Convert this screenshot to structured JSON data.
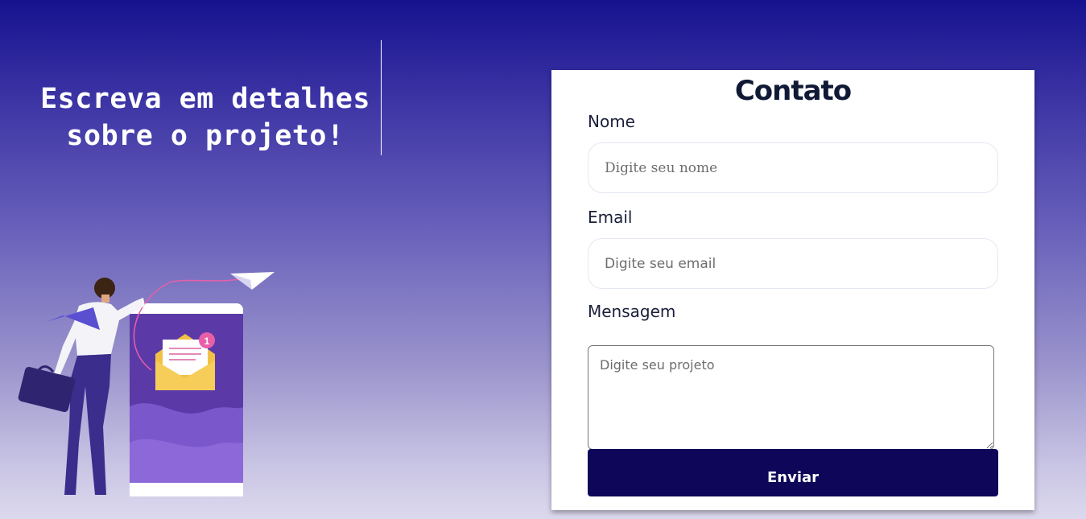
{
  "hero": {
    "headline_line1": "Escreva em detalhes",
    "headline_line2": "sobre o projeto!"
  },
  "form": {
    "title": "Contato",
    "name_label": "Nome",
    "name_placeholder": "Digite seu nome",
    "email_label": "Email",
    "email_placeholder": "Digite seu email",
    "message_label": "Mensagem",
    "message_placeholder": "Digite seu projeto",
    "submit_label": "Enviar"
  },
  "illustration": {
    "notification_count": "1"
  },
  "colors": {
    "background_top": "#16128f",
    "background_bottom": "#dcd9ee",
    "button": "#0d0659",
    "title": "#101a36"
  }
}
